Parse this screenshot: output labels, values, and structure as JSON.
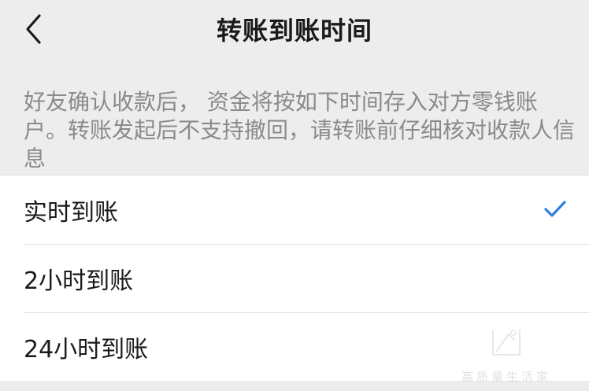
{
  "nav": {
    "title": "转账到账时间",
    "back_icon": "chevron-left-icon"
  },
  "description": "好友确认收款后， 资金将按如下时间存入对方零钱账户。转账发起后不支持撤回，请转账前仔细核对收款人信息",
  "options": [
    {
      "label": "实时到账",
      "selected": true
    },
    {
      "label": "2小时到账",
      "selected": false
    },
    {
      "label": "24小时到账",
      "selected": false
    }
  ],
  "colors": {
    "background": "#ededed",
    "check": "#2f7de1",
    "text_secondary": "#8a8a8a"
  },
  "watermark": {
    "text": "高质量生活家"
  }
}
